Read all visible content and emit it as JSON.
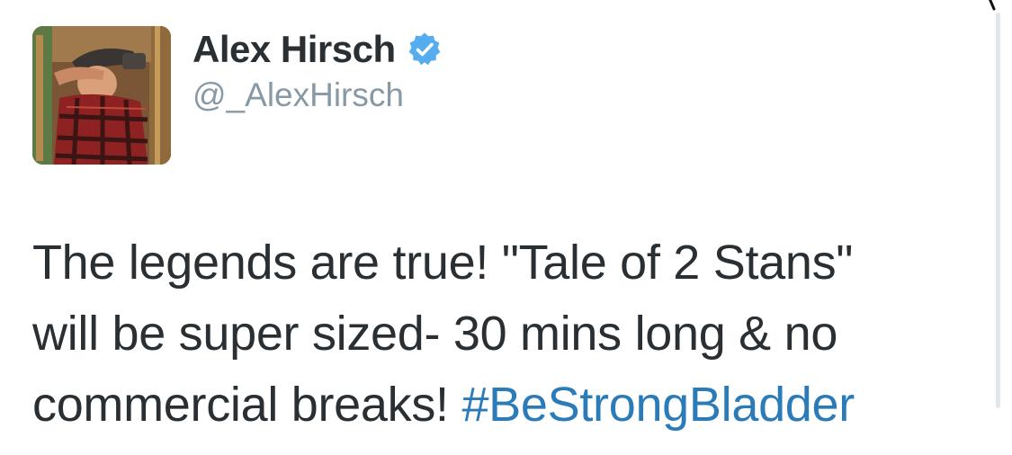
{
  "tweet": {
    "display_name": "Alex Hirsch",
    "handle": "@_AlexHirsch",
    "verified": true,
    "text_lines": [
      "The legends are true! \"Tale of 2 Stans\"",
      "will be super sized- 30 mins long & no",
      "commercial breaks! "
    ],
    "hashtag": "#BeStrongBladder"
  },
  "icons": {
    "verified": "verified-badge-icon",
    "avatar": "profile-photo"
  },
  "colors": {
    "text": "#292f33",
    "handle": "#8899a6",
    "hashtag": "#2b7bb9",
    "verified": "#55acee"
  }
}
